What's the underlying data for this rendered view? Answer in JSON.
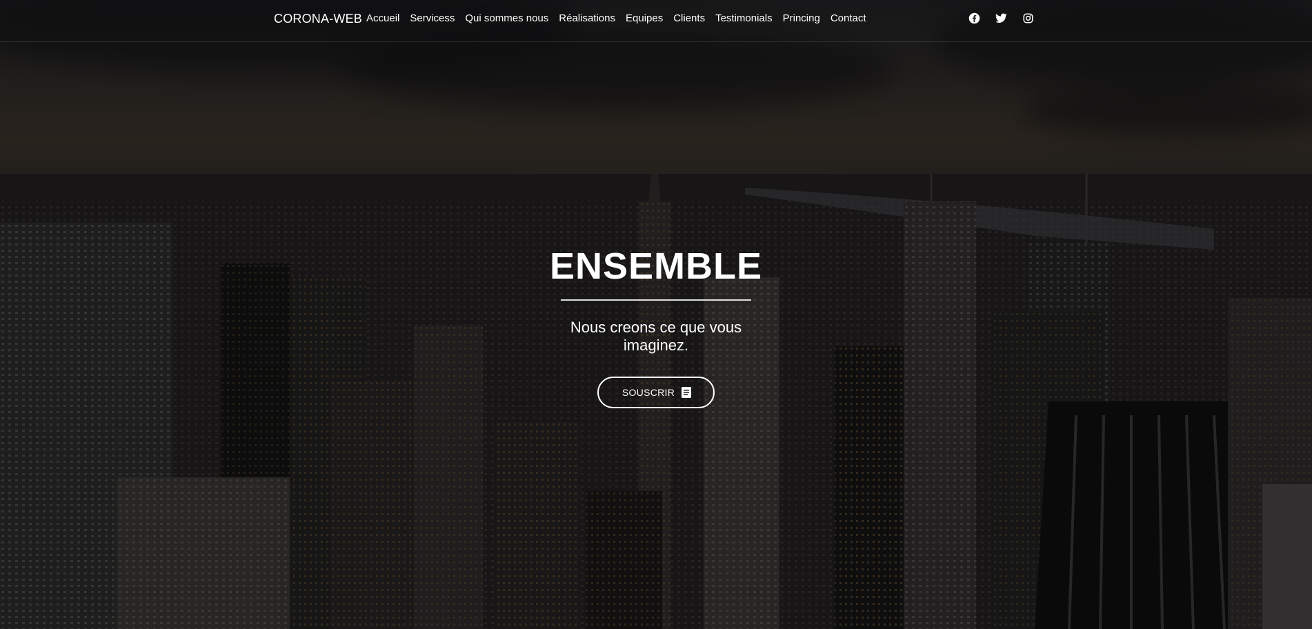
{
  "navbar": {
    "brand": "CORONA-WEB",
    "links": [
      "Accueil",
      "Servicess",
      "Qui sommes nous",
      "Réalisations",
      "Equipes",
      "Clients",
      "Testimonials",
      "Princing",
      "Contact"
    ],
    "socials": [
      "facebook-icon",
      "twitter-icon",
      "instagram-icon"
    ]
  },
  "hero": {
    "title": "ENSEMBLE",
    "subtitle": "Nous creons ce que vous imaginez.",
    "cta_label": "SOUSCRIR",
    "cta_icon": "book-icon",
    "background": "city skyline at dusk"
  },
  "colors": {
    "text": "#ffffff",
    "overlay": "rgba(0,0,0,0.45)"
  }
}
